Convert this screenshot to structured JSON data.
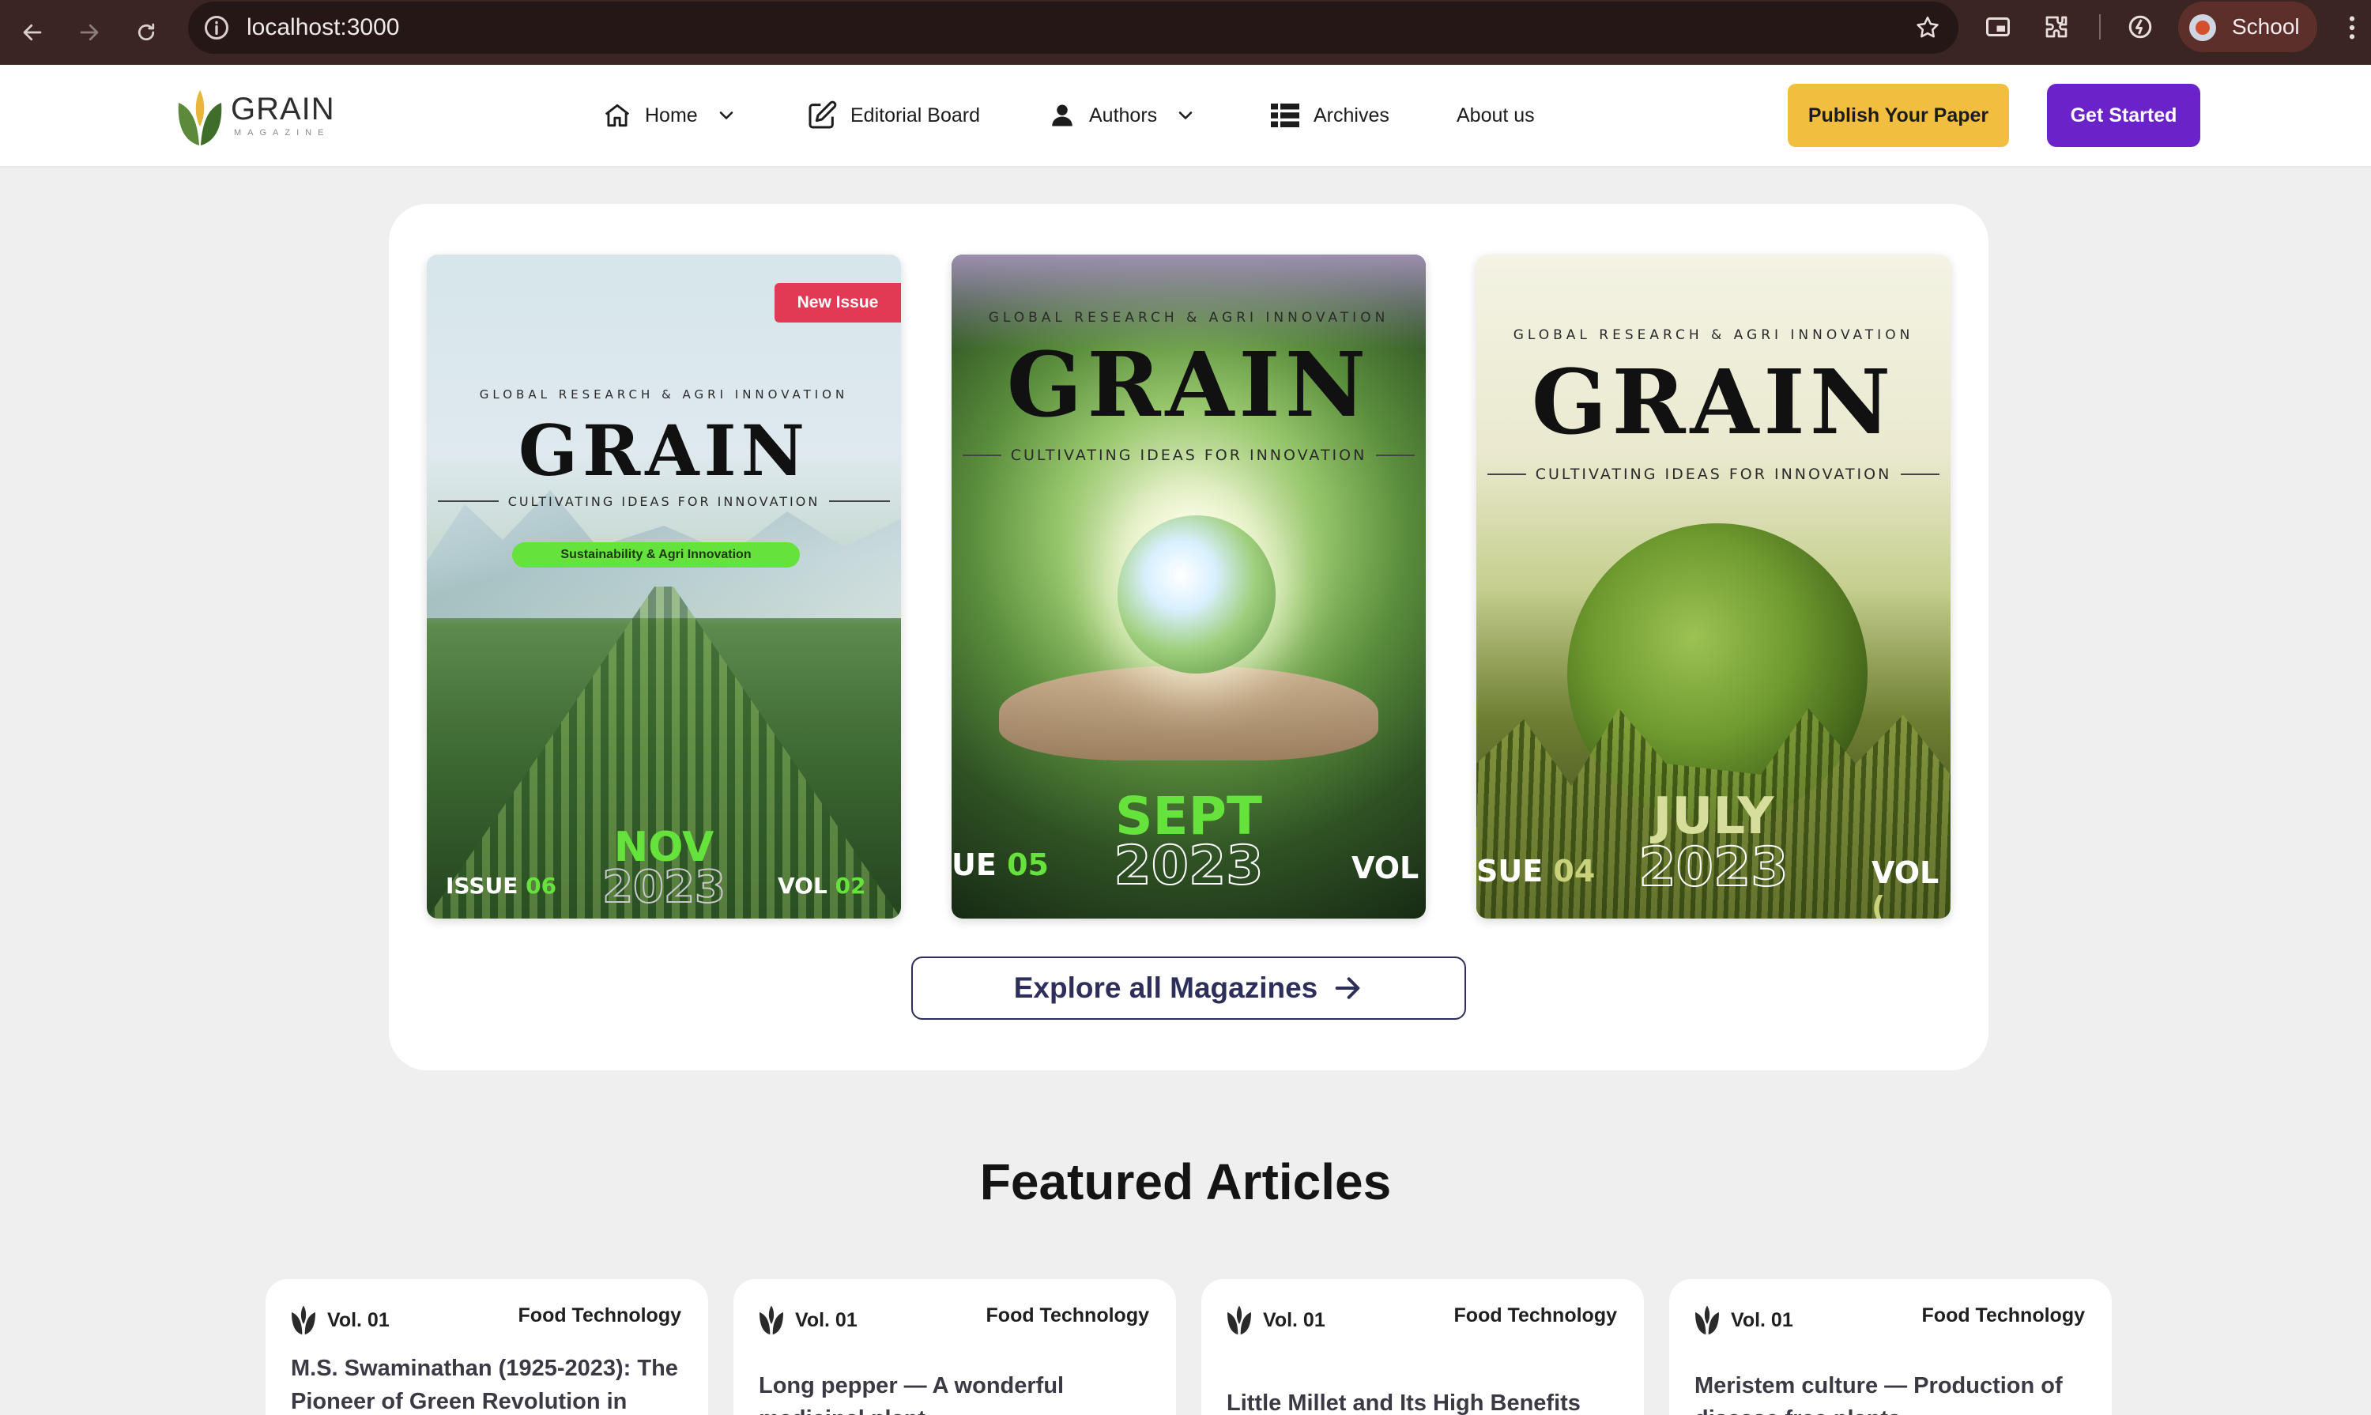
{
  "browser": {
    "url": "localhost:3000",
    "profile_name": "School"
  },
  "header": {
    "logo_word": "GRAIN",
    "logo_sub": "MAGAZINE",
    "nav": [
      {
        "label": "Home"
      },
      {
        "label": "Editorial Board"
      },
      {
        "label": "Authors"
      },
      {
        "label": "Archives"
      },
      {
        "label": "About us"
      }
    ],
    "publish_label": "Publish Your Paper",
    "start_label": "Get Started"
  },
  "magazines": {
    "covers": [
      {
        "tagline": "GLOBAL RESEARCH & AGRI INNOVATION",
        "title": "GRAIN",
        "subline": "CULTIVATING IDEAS FOR INNOVATION",
        "badge": "New Issue",
        "topic": "Sustainability & Agri Innovation",
        "month": "NOV",
        "year": "2023",
        "issue_label": "ISSUE",
        "issue_num": "06",
        "vol_label": "VOL",
        "vol_num": "02"
      },
      {
        "tagline": "GLOBAL RESEARCH & AGRI INNOVATION",
        "title": "GRAIN",
        "subline": "CULTIVATING IDEAS FOR INNOVATION",
        "month": "SEPT",
        "year": "2023",
        "issue_label": "UE",
        "issue_num": "05",
        "vol_label": "VOL"
      },
      {
        "tagline": "GLOBAL RESEARCH & AGRI INNOVATION",
        "title": "GRAIN",
        "subline": "CULTIVATING IDEAS FOR INNOVATION",
        "month": "JULY",
        "year": "2023",
        "issue_label": "SUE",
        "issue_num": "04",
        "vol_label": "VOL",
        "vol_num": "("
      }
    ],
    "explore_label": "Explore all Magazines"
  },
  "featured": {
    "title": "Featured Articles",
    "articles": [
      {
        "vol": "Vol. 01",
        "category": "Food Technology",
        "title": "M.S. Swaminathan (1925-2023): The Pioneer of Green Revolution in"
      },
      {
        "vol": "Vol. 01",
        "category": "Food Technology",
        "title": "Long pepper — A wonderful medicinal plant"
      },
      {
        "vol": "Vol. 01",
        "category": "Food Technology",
        "title": "Little Millet and Its High Benefits"
      },
      {
        "vol": "Vol. 01",
        "category": "Food Technology",
        "title": "Meristem culture — Production of disease free plants"
      }
    ]
  },
  "colors": {
    "accent_yellow": "#f2be3f",
    "accent_purple": "#6a23c9",
    "chrome_bg": "#3b2523",
    "badge_red": "#e23a55",
    "issue_green": "#66e23c"
  },
  "icons": [
    "back-arrow-icon",
    "forward-arrow-icon",
    "reload-icon",
    "info-icon",
    "star-icon",
    "picture-in-picture-icon",
    "extensions-icon",
    "performance-icon",
    "kebab-menu-icon",
    "home-icon",
    "edit-icon",
    "user-icon",
    "grid-icon",
    "chevron-down-icon",
    "arrow-right-icon",
    "leaf-logo-icon"
  ]
}
